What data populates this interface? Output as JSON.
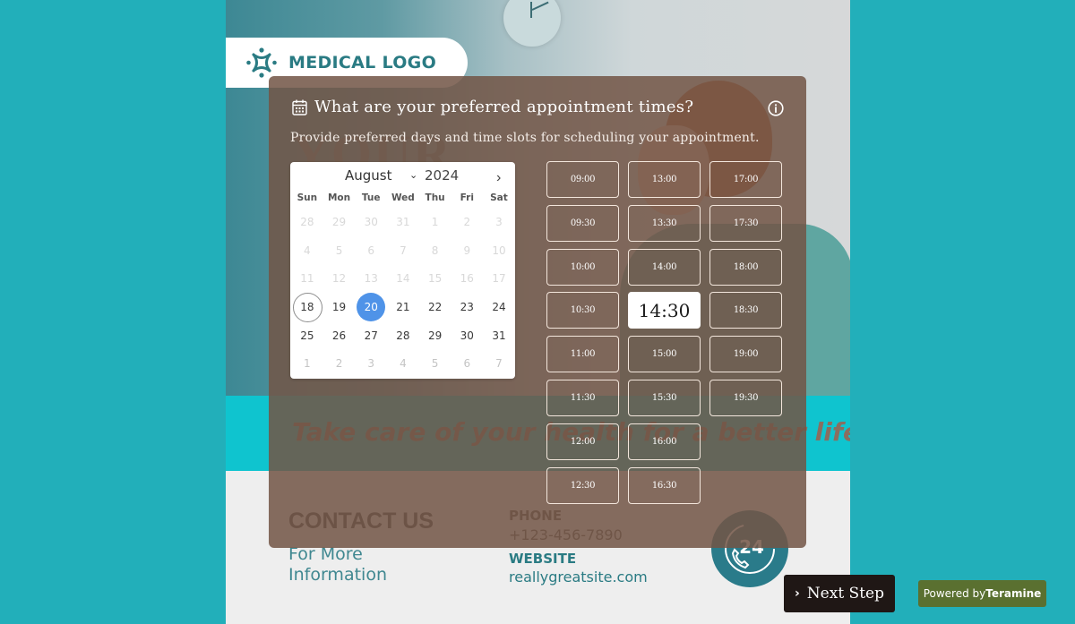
{
  "poster": {
    "logo_text": "MEDICAL LOGO",
    "headline_fragment": "YOUR",
    "tagline": "Take care of your health for a better life.",
    "contact_title": "CONTACT US",
    "contact_sub_line1": "For More",
    "contact_sub_line2": "Information",
    "phone_label": "PHONE",
    "phone_value": "+123-456-7890",
    "website_label": "WEBSITE",
    "website_value": "reallygreatsite.com",
    "badge_text": "24"
  },
  "modal": {
    "title": "What are your preferred appointment times?",
    "subtitle": "Provide preferred days and time slots for scheduling your appointment.",
    "title_icon": "calendar-icon",
    "info_icon": "info-icon"
  },
  "calendar": {
    "month": "August",
    "year": "2024",
    "next_icon": "chevron-right-icon",
    "weekdays": [
      "Sun",
      "Mon",
      "Tue",
      "Wed",
      "Thu",
      "Fri",
      "Sat"
    ],
    "weeks": [
      [
        {
          "d": "28",
          "s": "muted"
        },
        {
          "d": "29",
          "s": "muted"
        },
        {
          "d": "30",
          "s": "muted"
        },
        {
          "d": "31",
          "s": "muted"
        },
        {
          "d": "1",
          "s": "muted"
        },
        {
          "d": "2",
          "s": "muted"
        },
        {
          "d": "3",
          "s": "muted"
        }
      ],
      [
        {
          "d": "4",
          "s": "muted"
        },
        {
          "d": "5",
          "s": "muted"
        },
        {
          "d": "6",
          "s": "muted"
        },
        {
          "d": "7",
          "s": "muted"
        },
        {
          "d": "8",
          "s": "muted"
        },
        {
          "d": "9",
          "s": "muted"
        },
        {
          "d": "10",
          "s": "muted"
        }
      ],
      [
        {
          "d": "11",
          "s": "muted"
        },
        {
          "d": "12",
          "s": "muted"
        },
        {
          "d": "13",
          "s": "muted"
        },
        {
          "d": "14",
          "s": "muted"
        },
        {
          "d": "15",
          "s": "muted"
        },
        {
          "d": "16",
          "s": "muted"
        },
        {
          "d": "17",
          "s": "muted"
        }
      ],
      [
        {
          "d": "18",
          "s": "today"
        },
        {
          "d": "19",
          "s": ""
        },
        {
          "d": "20",
          "s": "selected"
        },
        {
          "d": "21",
          "s": ""
        },
        {
          "d": "22",
          "s": ""
        },
        {
          "d": "23",
          "s": ""
        },
        {
          "d": "24",
          "s": ""
        }
      ],
      [
        {
          "d": "25",
          "s": ""
        },
        {
          "d": "26",
          "s": ""
        },
        {
          "d": "27",
          "s": ""
        },
        {
          "d": "28",
          "s": ""
        },
        {
          "d": "29",
          "s": ""
        },
        {
          "d": "30",
          "s": ""
        },
        {
          "d": "31",
          "s": ""
        }
      ],
      [
        {
          "d": "1",
          "s": "other"
        },
        {
          "d": "2",
          "s": "other"
        },
        {
          "d": "3",
          "s": "other"
        },
        {
          "d": "4",
          "s": "other"
        },
        {
          "d": "5",
          "s": "other"
        },
        {
          "d": "6",
          "s": "other"
        },
        {
          "d": "7",
          "s": "other"
        }
      ]
    ],
    "today": "18",
    "selected": "20"
  },
  "time_slots": {
    "columns": [
      [
        "09:00",
        "09:30",
        "10:00",
        "10:30",
        "11:00",
        "11:30",
        "12:00",
        "12:30"
      ],
      [
        "13:00",
        "13:30",
        "14:00",
        "14:30",
        "15:00",
        "15:30",
        "16:00",
        "16:30"
      ],
      [
        "17:00",
        "17:30",
        "18:00",
        "18:30",
        "19:00",
        "19:30"
      ]
    ],
    "selected": "14:30"
  },
  "footer": {
    "next_label": "Next Step",
    "powered_prefix": "Powered by",
    "powered_brand": "Teramine"
  },
  "colors": {
    "page_bg": "#22afba",
    "modal_overlay": "#725546",
    "selected_day": "#4f93e8",
    "brand_teal": "#2a7b83",
    "next_button": "#1f1715",
    "powered_badge": "#5a7030"
  }
}
